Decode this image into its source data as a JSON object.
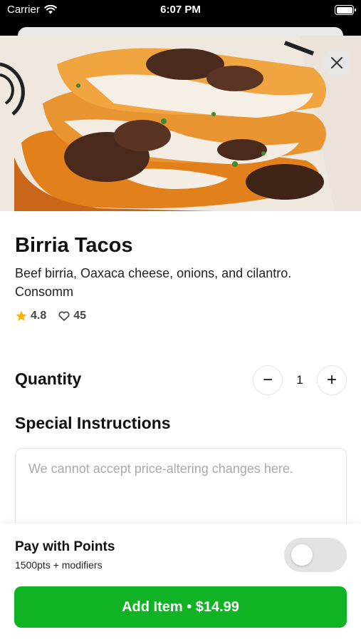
{
  "status_bar": {
    "carrier": "Carrier",
    "time": "6:07 PM",
    "wifi_icon": "wifi-icon",
    "battery_icon": "battery-icon"
  },
  "item": {
    "image_icon": "food-photo",
    "name": "Birria Tacos",
    "description": "Beef birria, Oaxaca cheese, onions, and cilantro. Consomm",
    "rating": "4.8",
    "likes": "45"
  },
  "quantity": {
    "label": "Quantity",
    "value": "1",
    "decrement_label": "−",
    "increment_label": "+"
  },
  "instructions": {
    "label": "Special Instructions",
    "placeholder": "We cannot accept price-altering changes here.",
    "value": ""
  },
  "points": {
    "title": "Pay with Points",
    "subtitle": "1500pts + modifiers",
    "enabled": false
  },
  "cta": {
    "label": "Add Item • $14.99"
  },
  "colors": {
    "accent": "#0fb324",
    "star": "#f5b800"
  }
}
